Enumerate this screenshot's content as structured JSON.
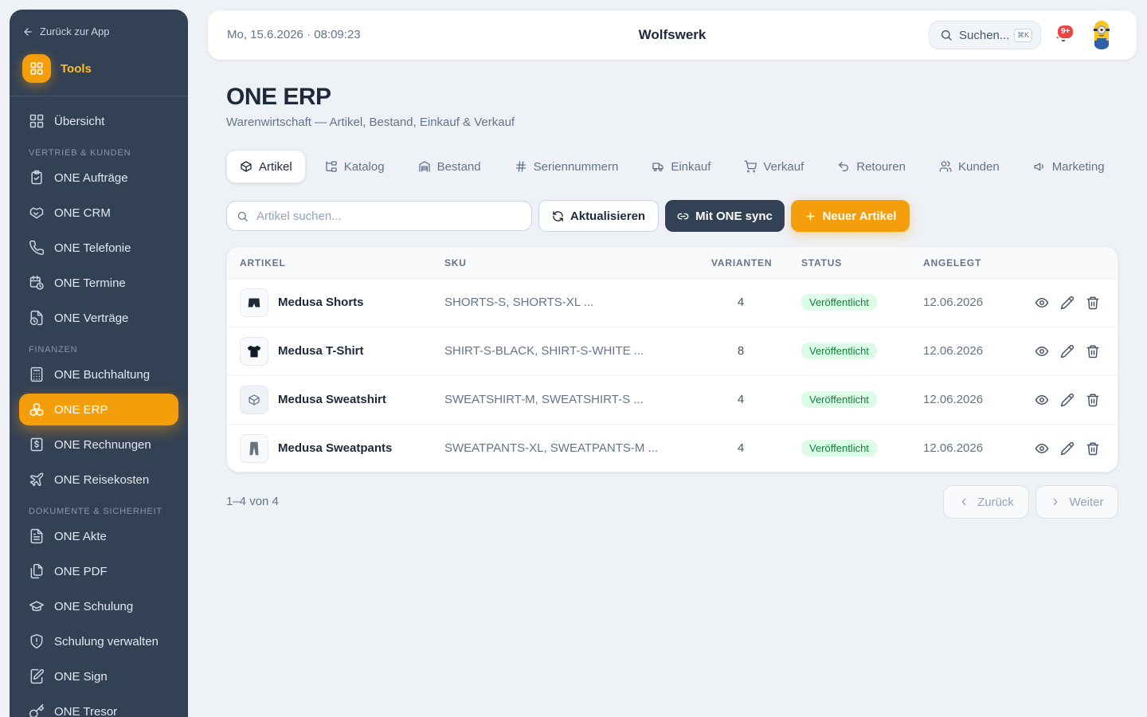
{
  "sidebar": {
    "back_label": "Zurück zur App",
    "brand_label": "Tools",
    "overview_label": "Übersicht",
    "sections": {
      "sales": "VERTRIEB & KUNDEN",
      "finance": "FINANZEN",
      "docs": "DOKUMENTE & SICHERHEIT"
    },
    "items": {
      "auftraege": "ONE Aufträge",
      "crm": "ONE CRM",
      "telefonie": "ONE Telefonie",
      "termine": "ONE Termine",
      "vertraege": "ONE Verträge",
      "buchhaltung": "ONE Buchhaltung",
      "erp": "ONE ERP",
      "rechnungen": "ONE Rechnungen",
      "reisekosten": "ONE Reisekosten",
      "akte": "ONE Akte",
      "pdf": "ONE PDF",
      "schulung": "ONE Schulung",
      "schulung_verwalten": "Schulung verwalten",
      "sign": "ONE Sign",
      "tresor": "ONE Tresor"
    },
    "active_item": "ONE ERP"
  },
  "topbar": {
    "datetime": "Mo, 15.6.2026 · 08:09:23",
    "company": "Wolfswerk",
    "search_label": "Suchen...",
    "search_shortcut": "⌘K",
    "notification_badge": "9+"
  },
  "page": {
    "title": "ONE ERP",
    "subtitle": "Warenwirtschaft — Artikel, Bestand, Einkauf & Verkauf"
  },
  "tabs": {
    "artikel": "Artikel",
    "katalog": "Katalog",
    "bestand": "Bestand",
    "seriennummern": "Seriennummern",
    "einkauf": "Einkauf",
    "verkauf": "Verkauf",
    "retouren": "Retouren",
    "kunden": "Kunden",
    "marketing": "Marketing",
    "active": "Artikel"
  },
  "toolbar": {
    "search_placeholder": "Artikel suchen...",
    "search_value": "",
    "refresh_label": "Aktualisieren",
    "sync_label": "Mit ONE sync",
    "new_label": "Neuer Artikel"
  },
  "table": {
    "headers": {
      "artikel": "ARTIKEL",
      "sku": "SKU",
      "varianten": "VARIANTEN",
      "status": "STATUS",
      "angelegt": "ANGELEGT"
    },
    "rows": [
      {
        "name": "Medusa Shorts",
        "sku": "SHORTS-S, SHORTS-XL ...",
        "variants": "4",
        "status": "Veröffentlicht",
        "created": "12.06.2026",
        "thumb_icon": "shorts-icon"
      },
      {
        "name": "Medusa T-Shirt",
        "sku": "SHIRT-S-BLACK, SHIRT-S-WHITE ...",
        "variants": "8",
        "status": "Veröffentlicht",
        "created": "12.06.2026",
        "thumb_icon": "tshirt-icon"
      },
      {
        "name": "Medusa Sweatshirt",
        "sku": "SWEATSHIRT-M, SWEATSHIRT-S ...",
        "variants": "4",
        "status": "Veröffentlicht",
        "created": "12.06.2026",
        "thumb_icon": "package-icon"
      },
      {
        "name": "Medusa Sweatpants",
        "sku": "SWEATPANTS-XL, SWEATPANTS-M ...",
        "variants": "4",
        "status": "Veröffentlicht",
        "created": "12.06.2026",
        "thumb_icon": "pants-icon"
      }
    ]
  },
  "pagination": {
    "info": "1–4 von 4",
    "prev_label": "Zurück",
    "next_label": "Weiter"
  },
  "colors": {
    "accent": "#f59e0b",
    "sidebar_bg": "#334155",
    "status_green": "#15803d",
    "badge_red": "#ef4444"
  }
}
